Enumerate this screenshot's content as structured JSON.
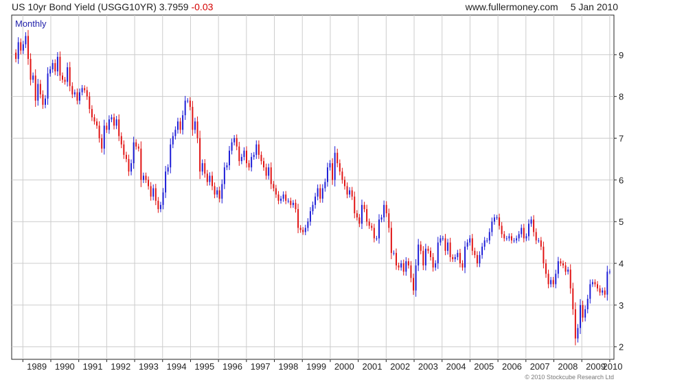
{
  "header": {
    "title": "US 10yr Bond Yield (USGG10YR)",
    "last": "3.7959",
    "change": "-0.03",
    "site": "www.fullermoney.com",
    "date": "5 Jan 2010"
  },
  "footer": {
    "copyright": "© 2010 Stockcube Research Ltd"
  },
  "colors": {
    "up": "#1a1ad6",
    "down": "#e01010",
    "grid": "#cccccc",
    "frame": "#222222",
    "label": "#2222aa"
  },
  "chart_data": {
    "type": "candlestick",
    "period_label": "Monthly",
    "x_range": [
      1988.6,
      2010.15
    ],
    "ylim": [
      1.7,
      9.95
    ],
    "y_ticks": [
      2,
      3,
      4,
      5,
      6,
      7,
      8,
      9
    ],
    "x_ticks": [
      "1989",
      "1990",
      "1991",
      "1992",
      "1993",
      "1994",
      "1995",
      "1996",
      "1997",
      "1998",
      "1999",
      "2000",
      "2001",
      "2002",
      "2003",
      "2004",
      "2005",
      "2006",
      "2007",
      "2008",
      "2009",
      "2010"
    ],
    "grid": true,
    "series": [
      {
        "name": "USGG10YR",
        "closes": [
          8.9,
          9.3,
          9.1,
          9.25,
          9.45,
          8.9,
          8.4,
          8.5,
          7.9,
          8.3,
          8.05,
          7.8,
          7.95,
          8.55,
          8.65,
          8.8,
          8.6,
          8.95,
          8.5,
          8.4,
          8.35,
          8.7,
          8.25,
          8.05,
          8.1,
          7.9,
          8.1,
          8.2,
          8.15,
          8.0,
          7.7,
          7.5,
          7.4,
          7.3,
          7.0,
          6.75,
          7.3,
          7.2,
          7.45,
          7.5,
          7.3,
          7.45,
          7.05,
          6.85,
          6.6,
          6.5,
          6.2,
          6.4,
          6.9,
          6.8,
          6.75,
          6.0,
          6.1,
          6.0,
          5.85,
          5.6,
          5.8,
          5.5,
          5.3,
          5.4,
          5.7,
          6.2,
          6.3,
          6.85,
          7.05,
          7.2,
          7.4,
          7.2,
          7.55,
          7.9,
          7.9,
          7.75,
          7.2,
          7.4,
          7.0,
          6.2,
          6.4,
          6.15,
          5.95,
          6.1,
          5.85,
          5.65,
          5.75,
          5.55,
          5.9,
          6.3,
          6.35,
          6.7,
          6.9,
          7.0,
          6.8,
          6.45,
          6.55,
          6.7,
          6.4,
          6.3,
          6.55,
          6.6,
          6.85,
          6.6,
          6.45,
          6.3,
          6.1,
          6.3,
          5.9,
          5.8,
          5.65,
          5.5,
          5.55,
          5.65,
          5.5,
          5.5,
          5.4,
          5.45,
          5.3,
          4.85,
          4.8,
          4.75,
          4.85,
          5.0,
          5.25,
          5.4,
          5.6,
          5.8,
          5.55,
          5.8,
          5.95,
          6.3,
          6.4,
          6.0,
          6.65,
          6.4,
          6.2,
          6.0,
          5.85,
          5.65,
          5.75,
          5.6,
          5.2,
          5.1,
          4.95,
          5.4,
          5.3,
          5.0,
          4.9,
          4.85,
          4.6,
          4.6,
          5.05,
          5.1,
          5.4,
          5.2,
          4.85,
          4.25,
          4.25,
          3.95,
          3.9,
          4.0,
          3.8,
          4.05,
          3.95,
          3.65,
          3.35,
          3.95,
          4.45,
          4.3,
          3.95,
          4.35,
          4.3,
          4.15,
          3.9,
          4.0,
          4.5,
          4.6,
          4.6,
          4.3,
          4.5,
          4.15,
          4.1,
          4.15,
          4.25,
          4.0,
          3.9,
          4.4,
          4.5,
          4.6,
          4.3,
          4.2,
          4.0,
          4.2,
          4.4,
          4.55,
          4.55,
          4.75,
          5.0,
          5.1,
          5.1,
          4.9,
          4.7,
          4.6,
          4.6,
          4.65,
          4.55,
          4.55,
          4.6,
          4.7,
          4.85,
          4.6,
          4.65,
          4.95,
          5.05,
          4.75,
          4.55,
          4.55,
          4.4,
          4.0,
          3.75,
          3.5,
          3.6,
          3.5,
          3.75,
          4.05,
          4.0,
          3.95,
          3.8,
          3.85,
          3.4,
          2.9,
          2.2,
          2.45,
          3.0,
          2.7,
          2.9,
          3.15,
          3.5,
          3.55,
          3.5,
          3.4,
          3.3,
          3.35,
          3.25,
          3.8,
          3.8
        ]
      }
    ]
  }
}
